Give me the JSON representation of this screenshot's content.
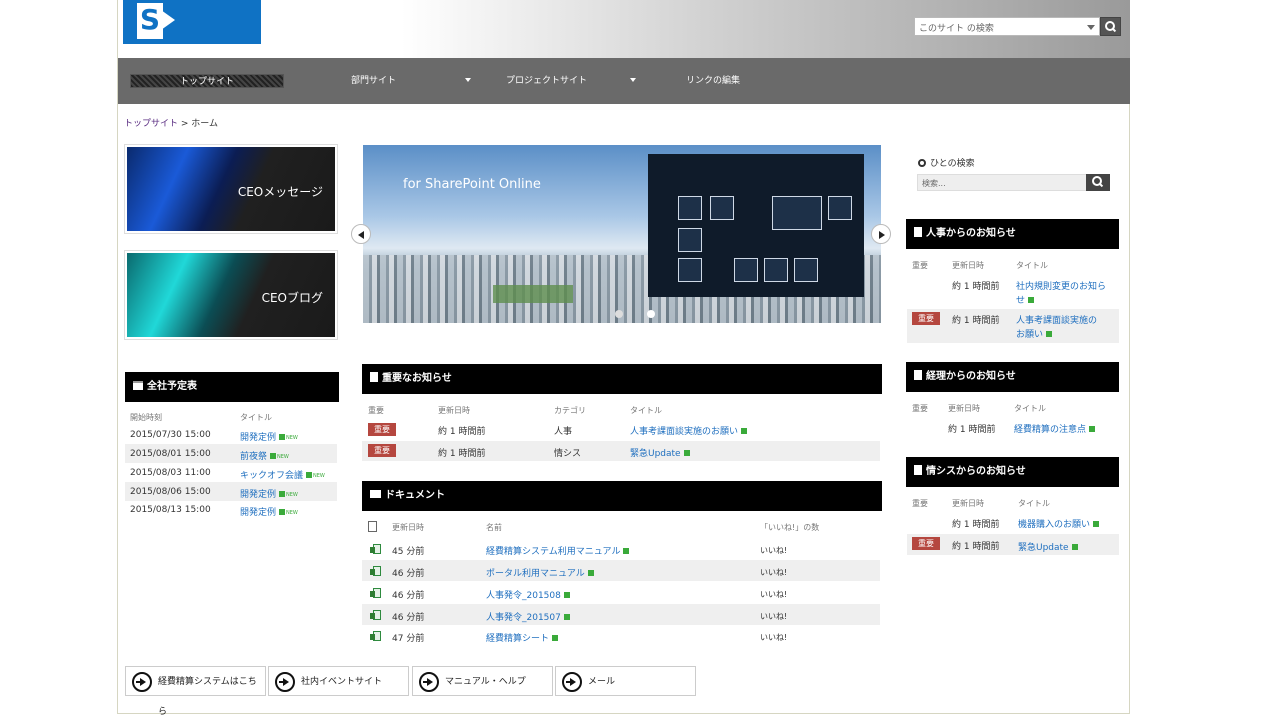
{
  "header": {
    "logo_letter": "S",
    "search_placeholder": "このサイト の検索"
  },
  "nav": {
    "items": [
      {
        "label": "トップサイト",
        "active": true
      },
      {
        "label": "部門サイト",
        "active": false
      },
      {
        "label": "プロジェクトサイト",
        "active": false
      },
      {
        "label": "リンクの編集",
        "active": false
      }
    ]
  },
  "breadcrumb": {
    "root": "トップサイト",
    "separator": " > ",
    "current": "ホーム"
  },
  "tiles": [
    {
      "label": "CEOメッセージ",
      "color": "#1a5ad8"
    },
    {
      "label": "CEOブログ",
      "color": "#20d8d8"
    }
  ],
  "carousel": {
    "tagline": "for SharePoint Online",
    "slide_count": 2,
    "active_slide": 2
  },
  "schedule": {
    "title": "全社予定表",
    "col_time": "開始時刻",
    "col_title": "タイトル",
    "new_tag": "NEW",
    "rows": [
      {
        "time": "2015/07/30 15:00",
        "title": "開発定例"
      },
      {
        "time": "2015/08/01 15:00",
        "title": "前夜祭"
      },
      {
        "time": "2015/08/03 11:00",
        "title": "キックオフ会議"
      },
      {
        "time": "2015/08/06 15:00",
        "title": "開発定例"
      },
      {
        "time": "2015/08/13 15:00",
        "title": "開発定例"
      }
    ]
  },
  "important": {
    "title": "重要なお知らせ",
    "cols": [
      "重要",
      "更新日時",
      "カテゴリ",
      "タイトル"
    ],
    "rows": [
      {
        "badge": "重要",
        "updated": "約 1 時間前",
        "category": "人事",
        "title": "人事考課面談実施のお願い"
      },
      {
        "badge": "重要",
        "updated": "約 1 時間前",
        "category": "情シス",
        "title": "緊急Update"
      }
    ]
  },
  "documents": {
    "title": "ドキュメント",
    "cols": [
      "更新日時",
      "名前",
      "「いいね!」の数"
    ],
    "rows": [
      {
        "updated": "45 分前",
        "name": "経費精算システム利用マニュアル",
        "likes": "いいね!"
      },
      {
        "updated": "46 分前",
        "name": "ポータル利用マニュアル",
        "likes": "いいね!"
      },
      {
        "updated": "46 分前",
        "name": "人事発令_201508",
        "likes": "いいね!"
      },
      {
        "updated": "46 分前",
        "name": "人事発令_201507",
        "likes": "いいね!"
      },
      {
        "updated": "47 分前",
        "name": "経費精算シート",
        "likes": "いいね!"
      }
    ]
  },
  "people_search": {
    "label": "ひとの検索",
    "placeholder": "検索..."
  },
  "hr_news": {
    "title": "人事からのお知らせ",
    "cols": [
      "重要",
      "更新日時",
      "タイトル"
    ],
    "rows": [
      {
        "badge": "",
        "updated": "約 1 時間前",
        "title_l1": "社内規則変更のお知ら",
        "title_l2": "せ"
      },
      {
        "badge": "重要",
        "updated": "約 1 時間前",
        "title_l1": "人事考課面談実施の",
        "title_l2": "お願い"
      }
    ]
  },
  "acct_news": {
    "title": "経理からのお知らせ",
    "cols": [
      "重要",
      "更新日時",
      "タイトル"
    ],
    "rows": [
      {
        "badge": "",
        "updated": "約 1 時間前",
        "title": "経費精算の注意点"
      }
    ]
  },
  "it_news": {
    "title": "情シスからのお知らせ",
    "cols": [
      "重要",
      "更新日時",
      "タイトル"
    ],
    "rows": [
      {
        "badge": "",
        "updated": "約 1 時間前",
        "title": "機器購入のお願い"
      },
      {
        "badge": "重要",
        "updated": "約 1 時間前",
        "title": "緊急Update"
      }
    ]
  },
  "quick_links": [
    {
      "label": "経費精算システムはこちら"
    },
    {
      "label": "社内イベントサイト"
    },
    {
      "label": "マニュアル・ヘルプ"
    },
    {
      "label": "メール"
    }
  ],
  "colors": {
    "brand_blue": "#0f72c4",
    "nav_gray": "#6a6a6a",
    "important_red": "#b5473f",
    "link_blue": "#1f6fbf",
    "new_green": "#3aaa3a"
  }
}
